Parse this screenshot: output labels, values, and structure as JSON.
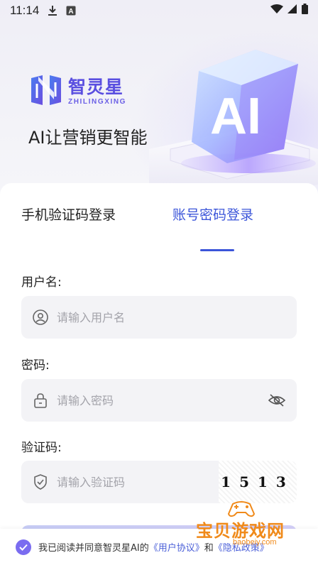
{
  "status_bar": {
    "time": "11:14"
  },
  "brand": {
    "name_cn": "智灵星",
    "name_en": "ZHILINGXING",
    "slogan": "AI让营销更智能",
    "art_text": "AI",
    "accent_color": "#5a4fe0"
  },
  "tabs": [
    {
      "label": "手机验证码登录",
      "active": false
    },
    {
      "label": "账号密码登录",
      "active": true
    }
  ],
  "form": {
    "username": {
      "label": "用户名:",
      "placeholder": "请输入用户名",
      "value": ""
    },
    "password": {
      "label": "密码:",
      "placeholder": "请输入密码",
      "value": ""
    },
    "captcha": {
      "label": "验证码:",
      "placeholder": "请输入验证码",
      "value": "",
      "image_code": "1513"
    }
  },
  "agreement": {
    "checked": true,
    "prefix": "我已阅读并同意智灵星AI的",
    "user_agreement": "《用户协议》",
    "and": "和",
    "privacy_policy": "《隐私政策》"
  },
  "watermark": {
    "text_cn": "宝贝游戏网",
    "text_en": "baobeiy.com"
  },
  "colors": {
    "active_tab": "#3b55d9",
    "link": "#4a5fd8",
    "checkbox": "#7a6cf0",
    "watermark": "#f08a1a"
  }
}
